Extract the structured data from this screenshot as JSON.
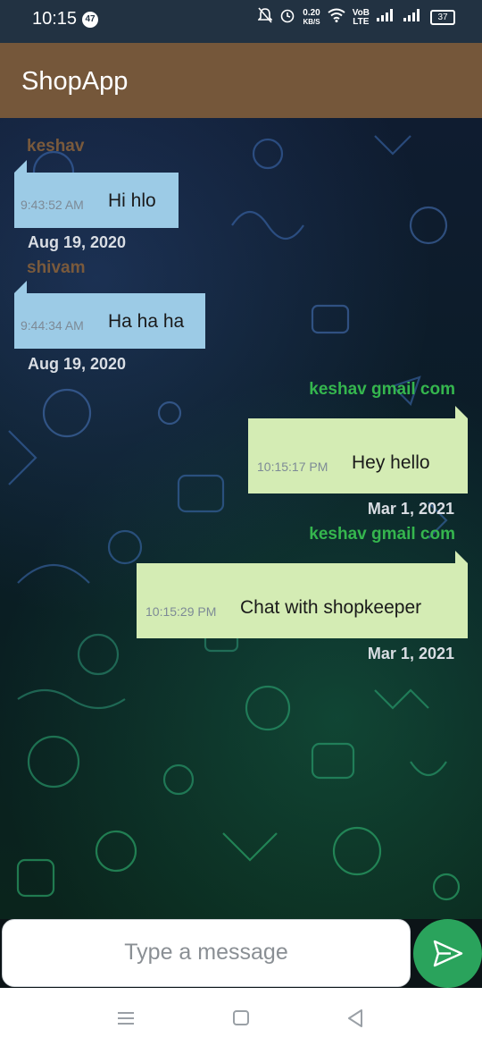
{
  "status_bar": {
    "time": "10:15",
    "notification_count": "47",
    "net_speed_value": "0.20",
    "net_speed_unit": "KB/S",
    "network_label_top": "VoB",
    "network_label_bottom": "LTE",
    "battery": "37"
  },
  "app_bar": {
    "title": "ShopApp"
  },
  "messages": [
    {
      "sender": "keshav",
      "time": "9:43:52 AM",
      "text": "Hi hlo",
      "date": "Aug 19, 2020",
      "direction": "incoming"
    },
    {
      "sender": "shivam",
      "time": "9:44:34 AM",
      "text": "Ha ha ha",
      "date": "Aug 19, 2020",
      "direction": "incoming"
    },
    {
      "sender": "keshav gmail com",
      "time": "10:15:17 PM",
      "text": "Hey hello",
      "date": "Mar 1, 2021",
      "direction": "outgoing"
    },
    {
      "sender": "keshav gmail com",
      "time": "10:15:29 PM",
      "text": "Chat with shopkeeper",
      "date": "Mar 1, 2021",
      "direction": "outgoing"
    }
  ],
  "composer": {
    "placeholder": "Type a message"
  },
  "colors": {
    "app_bar": "#75573a",
    "incoming_bubble": "#9ccbe6",
    "outgoing_bubble": "#d4ecb4",
    "incoming_sender": "#7a5a3c",
    "outgoing_sender": "#35b64e",
    "send_button": "#2aa35c"
  },
  "icons": {
    "send": "send-icon",
    "nav_menu": "menu-icon",
    "nav_home": "home-icon",
    "nav_back": "back-icon"
  }
}
